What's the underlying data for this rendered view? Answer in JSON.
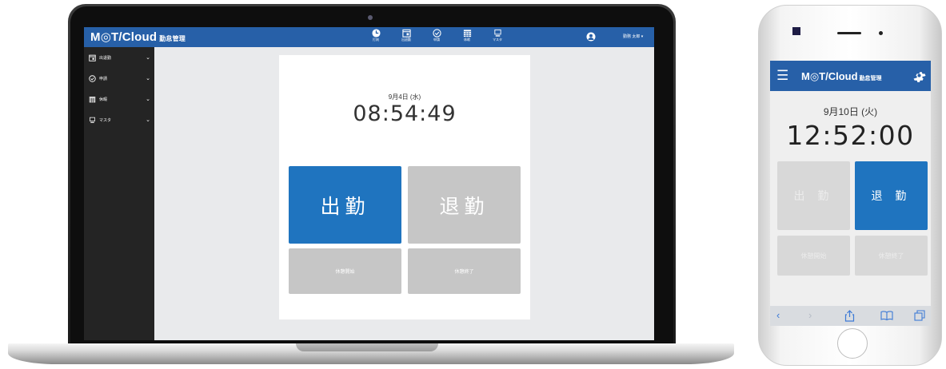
{
  "app": {
    "logo_text": "M◎T/Cloud",
    "logo_sub": "勤怠管理"
  },
  "desktop": {
    "nav": [
      {
        "label": "打刻",
        "icon": "clock-icon"
      },
      {
        "label": "出退勤",
        "icon": "calendar-icon"
      },
      {
        "label": "申請",
        "icon": "check-circle-icon"
      },
      {
        "label": "休暇",
        "icon": "calendar-grid-icon"
      },
      {
        "label": "マスタ",
        "icon": "monitor-icon"
      }
    ],
    "user_name": "勤務 太郎 ▾",
    "sidebar": [
      {
        "label": "出退勤",
        "icon": "calendar-icon"
      },
      {
        "label": "申請",
        "icon": "check-circle-icon"
      },
      {
        "label": "休暇",
        "icon": "calendar-grid-icon"
      },
      {
        "label": "マスタ",
        "icon": "monitor-icon"
      }
    ],
    "date": "9月4日 (水)",
    "time": "08:54:49",
    "buttons": {
      "clock_in": "出勤",
      "clock_out": "退勤",
      "break_start": "休憩開始",
      "break_end": "休憩終了"
    }
  },
  "mobile": {
    "date": "9月10日 (火)",
    "time": "12:52:00",
    "buttons": {
      "clock_in": "出 勤",
      "clock_out": "退 勤",
      "break_start": "休憩開始",
      "break_end": "休憩終了"
    },
    "toolbar": {
      "back": "‹",
      "forward": "›"
    }
  },
  "colors": {
    "brand": "#2760a8",
    "active_button": "#1f74bf",
    "inactive_button": "#c6c6c6",
    "sidebar": "#242424"
  }
}
